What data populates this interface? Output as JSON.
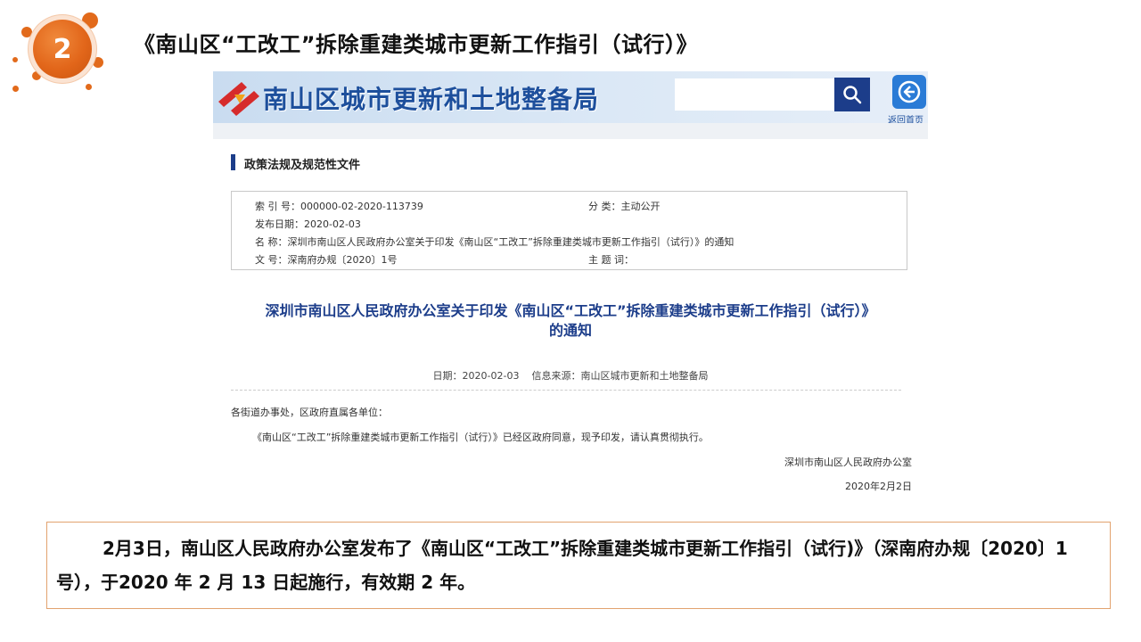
{
  "slide": {
    "number": "2",
    "title": "《南山区“工改工”拆除重建类城市更新工作指引（试行）》"
  },
  "site": {
    "name": "南山区城市更新和土地整备局",
    "search": {
      "placeholder": ""
    },
    "home_label": "返回首页",
    "section_title": "政策法规及规范性文件"
  },
  "meta": {
    "index_key": "索 引 号：",
    "index_val": "000000-02-2020-113739",
    "category_key": "分  类：",
    "category_val": "主动公开",
    "date_key": "发布日期：",
    "date_val": "2020-02-03",
    "name_key": "名  称：",
    "name_val": "深圳市南山区人民政府办公室关于印发《南山区“工改工”拆除重建类城市更新工作指引（试行）》的通知",
    "docno_key": "文  号：",
    "docno_val": "深南府办规〔2020〕1号",
    "subject_key": "主 题 词："
  },
  "document": {
    "title_line1": "深圳市南山区人民政府办公室关于印发《南山区“工改工”拆除重建类城市更新工作指引（试行）》",
    "title_line2": "的通知",
    "info": "日期：2020-02-03    信息来源：南山区城市更新和土地整备局",
    "salutation": "各街道办事处，区政府直属各单位：",
    "body": "《南山区“工改工”拆除重建类城市更新工作指引（试行）》已经区政府同意，现予印发，请认真贯彻执行。",
    "signature": "深圳市南山区人民政府办公室",
    "sign_date": "2020年2月2日"
  },
  "caption": {
    "text": "2月3日，南山区人民政府办公室发布了《南山区“工改工”拆除重建类城市更新工作指引（试行)》（深南府办规〔2020〕1号），于2020 年 2 月 13 日起施行，有效期 2 年。"
  },
  "colors": {
    "accent_orange": "#e2661a",
    "site_blue": "#1c3d8a",
    "caption_border": "#e2a36f"
  }
}
